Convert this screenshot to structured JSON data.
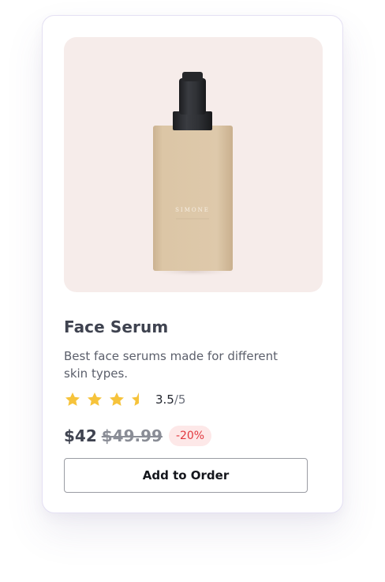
{
  "product": {
    "brand_mark": "SIMONE",
    "title": "Face Serum",
    "description": "Best face serums made for different skin types.",
    "rating": {
      "value": "3.5",
      "max": "/5",
      "stars_filled": 3.5,
      "stars_total": 4,
      "star_color": "#f6c33b"
    },
    "price": {
      "current": "$42",
      "original": "$49.99",
      "discount": "-20%"
    },
    "action": {
      "add_label": "Add to Order"
    }
  },
  "colors": {
    "image_background": "#f6ecea",
    "bottle_body": "#dcc6a6",
    "bottle_cap": "#2f3135",
    "discount_text": "#e2393f",
    "discount_background": "#fde8e8"
  }
}
